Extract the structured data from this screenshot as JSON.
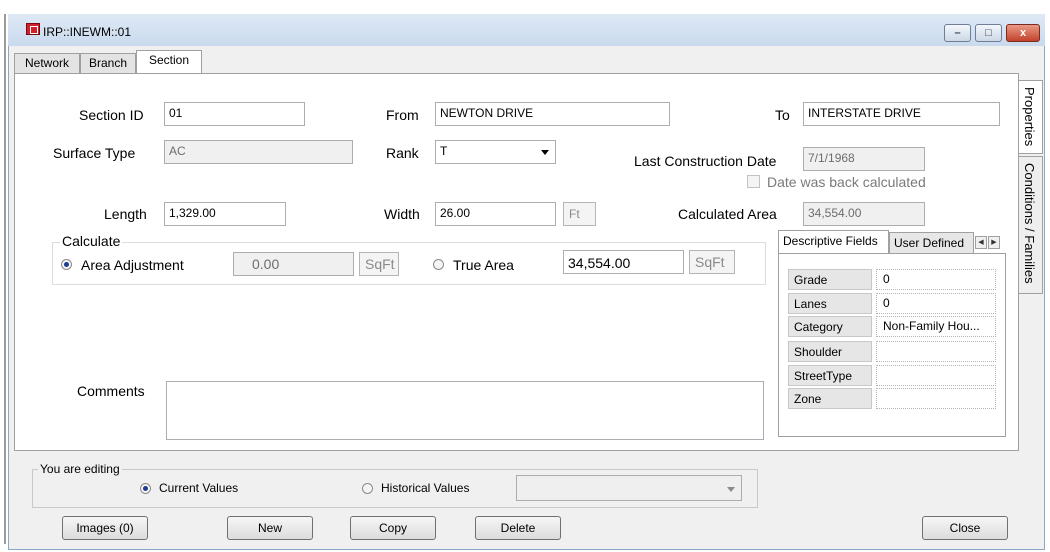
{
  "window": {
    "title": "IRP::INEWM::01",
    "minimize": "–",
    "maximize": "□",
    "close": "x"
  },
  "tabs": [
    {
      "label": "Network"
    },
    {
      "label": "Branch"
    },
    {
      "label": "Section"
    }
  ],
  "side_tabs": [
    {
      "label": "Properties"
    },
    {
      "label": "Conditions / Families"
    }
  ],
  "form": {
    "section_id_label": "Section ID",
    "section_id": "01",
    "from_label": "From",
    "from": "NEWTON DRIVE",
    "to_label": "To",
    "to": "INTERSTATE DRIVE",
    "surface_type_label": "Surface Type",
    "surface_type": "AC",
    "rank_label": "Rank",
    "rank": "T",
    "last_construction_label": "Last Construction Date",
    "last_construction": "7/1/1968",
    "back_calc_label": "Date was back calculated",
    "length_label": "Length",
    "length": "1,329.00",
    "width_label": "Width",
    "width": "26.00",
    "width_unit": "Ft",
    "calc_area_label": "Calculated Area",
    "calc_area": "34,554.00",
    "comments_label": "Comments",
    "comments": ""
  },
  "calculate": {
    "legend": "Calculate",
    "area_adjustment_label": "Area Adjustment",
    "area_adjustment": "0.00",
    "area_adjustment_unit": "SqFt",
    "true_area_label": "True Area",
    "true_area": "34,554.00",
    "true_area_unit": "SqFt"
  },
  "fields_panel": {
    "tabs": [
      {
        "label": "Descriptive Fields"
      },
      {
        "label": "User Defined"
      }
    ],
    "prev_arrow": "◀",
    "next_arrow": "▶",
    "rows": [
      {
        "label": "Grade",
        "value": "0"
      },
      {
        "label": "Lanes",
        "value": "0"
      },
      {
        "label": "Category",
        "value": "Non-Family Hou..."
      },
      {
        "label": "Shoulder",
        "value": ""
      },
      {
        "label": "StreetType",
        "value": ""
      },
      {
        "label": "Zone",
        "value": ""
      }
    ]
  },
  "editing": {
    "legend": "You are editing",
    "current_label": "Current Values",
    "historical_label": "Historical Values",
    "historical_select": ""
  },
  "buttons": {
    "images": "Images (0)",
    "new": "New",
    "copy": "Copy",
    "delete": "Delete",
    "close": "Close"
  }
}
